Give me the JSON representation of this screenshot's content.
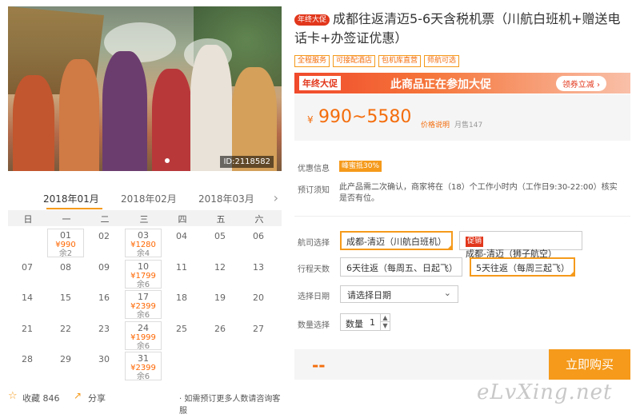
{
  "photo": {
    "id_label": "ID:2118582"
  },
  "calendar": {
    "months": [
      "2018年01月",
      "2018年02月",
      "2018年03月"
    ],
    "weekdays": [
      "日",
      "一",
      "二",
      "三",
      "四",
      "五",
      "六"
    ],
    "rows": [
      [
        {
          "d": ""
        },
        {
          "d": "01",
          "p": "¥990",
          "s": "余2"
        },
        {
          "d": "02"
        },
        {
          "d": "03",
          "p": "¥1280",
          "s": "余4"
        },
        {
          "d": "04"
        },
        {
          "d": "05"
        },
        {
          "d": "06"
        }
      ],
      [
        {
          "d": "07"
        },
        {
          "d": "08"
        },
        {
          "d": "09"
        },
        {
          "d": "10",
          "p": "¥1799",
          "s": "余6"
        },
        {
          "d": "11"
        },
        {
          "d": "12"
        },
        {
          "d": "13"
        }
      ],
      [
        {
          "d": "14"
        },
        {
          "d": "15"
        },
        {
          "d": "16"
        },
        {
          "d": "17",
          "p": "¥2399",
          "s": "余6"
        },
        {
          "d": "18"
        },
        {
          "d": "19"
        },
        {
          "d": "20"
        }
      ],
      [
        {
          "d": "21"
        },
        {
          "d": "22"
        },
        {
          "d": "23"
        },
        {
          "d": "24",
          "p": "¥1999",
          "s": "余6"
        },
        {
          "d": "25"
        },
        {
          "d": "26"
        },
        {
          "d": "27"
        }
      ],
      [
        {
          "d": "28"
        },
        {
          "d": "29"
        },
        {
          "d": "30"
        },
        {
          "d": "31",
          "p": "¥2399",
          "s": "余6"
        },
        {
          "d": ""
        },
        {
          "d": ""
        },
        {
          "d": ""
        }
      ]
    ]
  },
  "actions": {
    "favorite": "收藏 846",
    "share": "分享",
    "more_people": "· 如需预订更多人数请咨询客服"
  },
  "product": {
    "year_badge": "年终大促",
    "title": "成都往返清迈5-6天含税机票（川航白班机+赠送电话卡+办签证优惠）",
    "tags": [
      "全程服务",
      "可接配酒店",
      "包机库直营",
      "师航可选"
    ]
  },
  "promo": {
    "label": "年终大促",
    "text": "此商品正在参加大促",
    "coupon": "领券立减 ›"
  },
  "price": {
    "yen": "¥",
    "range": "990~5580",
    "note": "价格说明",
    "sold": "月售147"
  },
  "info": {
    "discount_label": "优惠信息",
    "discount_value": "峰蜜抵30%",
    "notice_label": "预订须知",
    "notice_value": "此产品需二次确认，商家将在（18）个工作小时内（工作日9:30-22:00）核实是否有位。"
  },
  "options": {
    "route_label": "航司选择",
    "route_a": "成都-清迈（川航白班机）",
    "route_b_badge": "促销",
    "route_b": "成都-清迈（狮子航空）",
    "days_label": "行程天数",
    "days_a": "6天往返（每周五、日起飞）",
    "days_b": "5天往返（每周三起飞）",
    "date_label": "选择日期",
    "date_value": "请选择日期",
    "qty_label": "数量选择",
    "qty_name": "数量",
    "qty_value": "1"
  },
  "buy": {
    "price_placeholder": "--",
    "button": "立即购买"
  },
  "watermark": "eLvXing.net"
}
